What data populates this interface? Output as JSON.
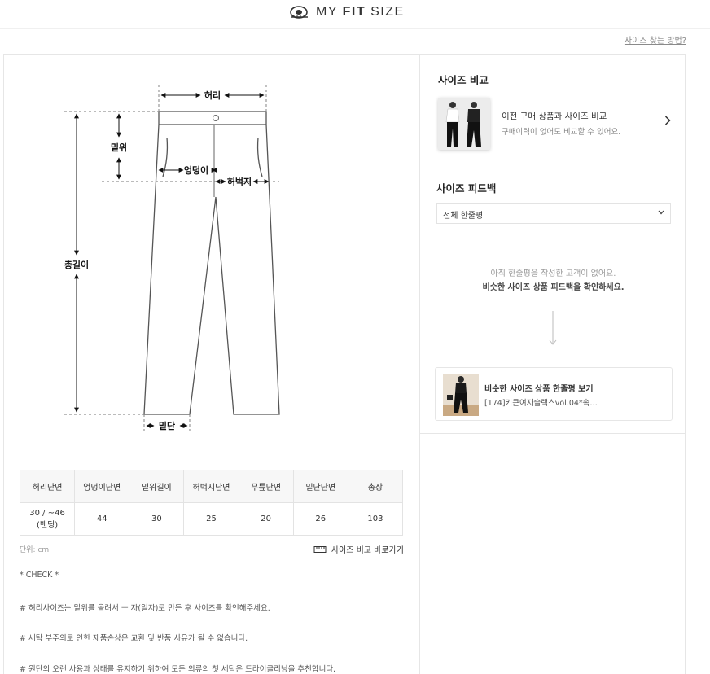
{
  "header": {
    "brand_prefix": "MY ",
    "brand_bold": "FIT",
    "brand_suffix": " SIZE",
    "guide_link": "사이즈 찾는 방법?"
  },
  "diagram": {
    "labels": {
      "waist": "허리",
      "rise": "밑위",
      "hip": "엉덩이",
      "thigh": "허벅지",
      "length": "총길이",
      "hem": "밑단"
    }
  },
  "table": {
    "headers": [
      "허리단면",
      "엉덩이단면",
      "밑위길이",
      "허벅지단면",
      "무릎단면",
      "밑단단면",
      "총장"
    ],
    "row": [
      "30 / ~46 (밴딩)",
      "44",
      "30",
      "25",
      "20",
      "26",
      "103"
    ]
  },
  "unit_label": "단위: cm",
  "compare_link": "사이즈 비교 바로가기",
  "notes": [
    "* CHECK *",
    "# 허리사이즈는 밑위를 올려서 ㅡ 자(일자)로 만든 후 사이즈를 확인해주세요.",
    "# 세탁 부주의로 인한 제품손상은 교환 및 반품 사유가 될 수 없습니다.",
    "# 원단의 오랜 사용과 상태를 유지하기 위하여 모든 의류의 첫 세탁은 드라이클리닝을 추천합니다."
  ],
  "size_compare": {
    "title": "사이즈 비교",
    "card_title": "이전 구매 상품과 사이즈 비교",
    "card_desc": "구매이력이 없어도 비교할 수 있어요."
  },
  "feedback": {
    "title": "사이즈 피드백",
    "select_value": "전체 한줄평",
    "empty_line1": "아직 한줄평을 작성한 고객이 없어요.",
    "empty_line2": "비슷한 사이즈 상품 피드백을 확인하세요.",
    "similar_title": "비슷한 사이즈 상품 한줄평 보기",
    "similar_sub": "[174]키큰여자슬랙스vol.04*속…"
  },
  "icons": {
    "brand": "tape-measure-icon",
    "ruler": "ruler-icon",
    "chevron": "chevron-right-icon",
    "caret": "chevron-down-icon",
    "arrow": "arrow-down-icon"
  },
  "colors": {
    "border": "#e6e6e6",
    "header_bg": "#f7f7f7",
    "text": "#333333",
    "muted": "#9a9a9a"
  }
}
